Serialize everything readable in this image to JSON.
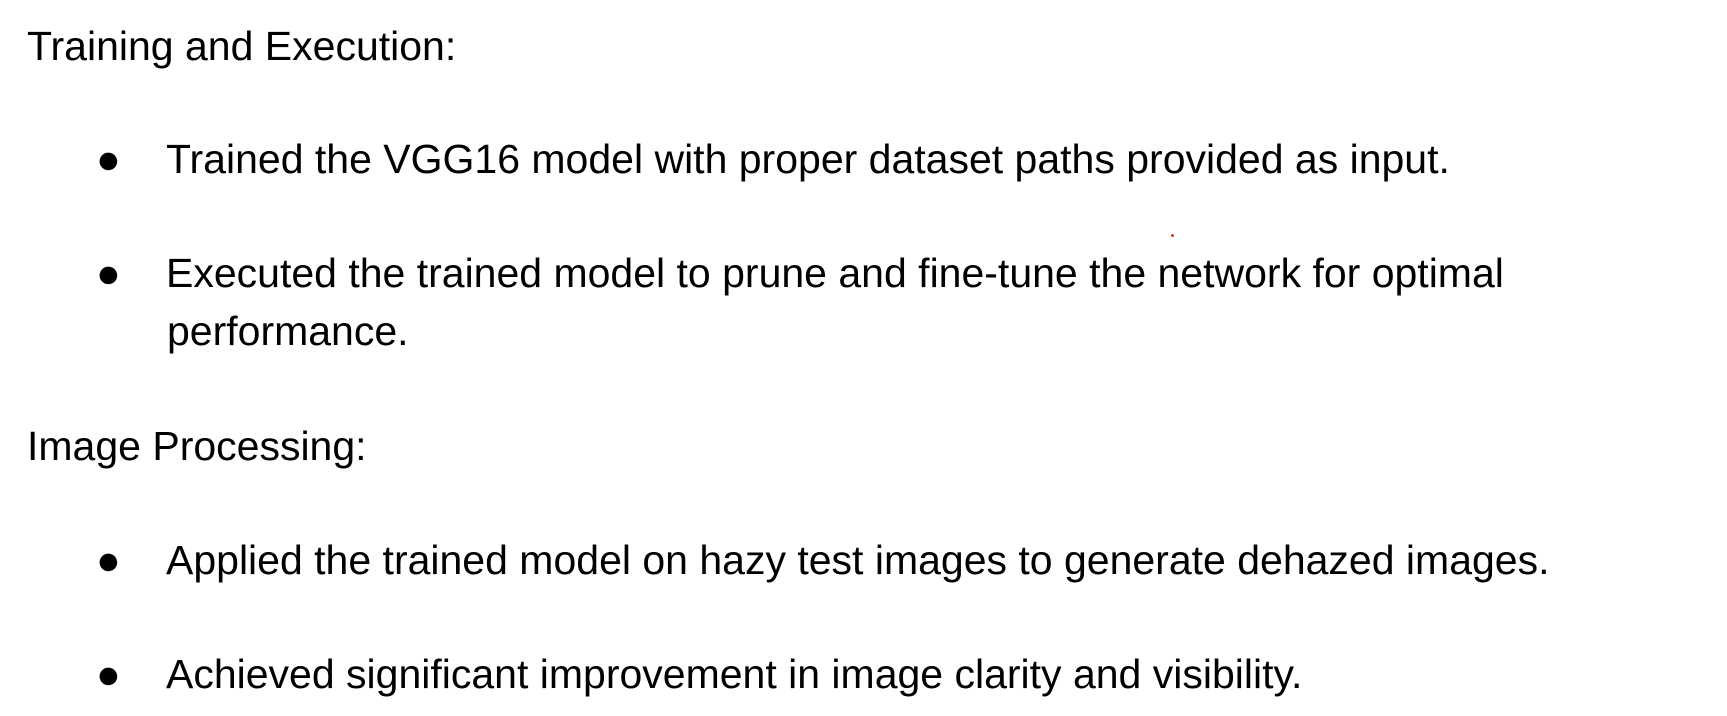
{
  "sections": [
    {
      "heading": "Training and Execution:",
      "bullets": [
        {
          "marker": "●",
          "text": "Trained the VGG16 model with proper dataset paths provided as input."
        },
        {
          "marker": "●",
          "line1": "Executed the trained model to prune and fine-tune the network for optimal",
          "line2": "performance."
        }
      ]
    },
    {
      "heading": "Image Processing:",
      "bullets": [
        {
          "marker": "●",
          "text": "Applied the trained model on hazy test images to generate dehazed images."
        },
        {
          "marker": "●",
          "text": "Achieved significant improvement in image clarity and visibility."
        }
      ]
    }
  ],
  "colors": {
    "text": "#000000",
    "background": "#ffffff",
    "stray_mark": "#d93025"
  }
}
